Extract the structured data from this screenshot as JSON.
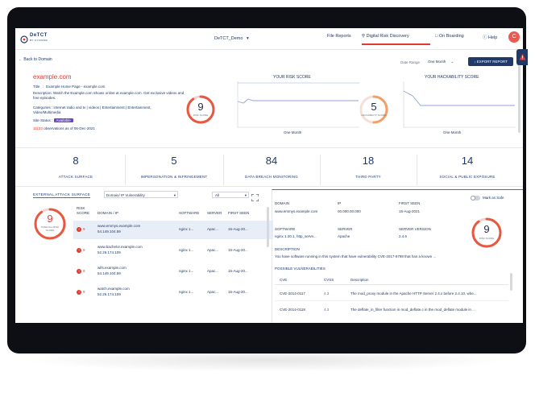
{
  "app": {
    "logo_text": "DeTCT",
    "logo_sub": "BY CYFIRMA",
    "workspace": "DeTCT_Demo",
    "nav": [
      "File Reports",
      "Digital Risk Discovery",
      "On Boarding",
      "Help"
    ],
    "avatar_letter": "C"
  },
  "toolbar": {
    "back_label": "Back to Domain",
    "date_range_label": "Date Range",
    "date_range_value": "One Month",
    "export_label": "EXPORT REPORT"
  },
  "domain": {
    "name": "example.com",
    "title_label": "Title",
    "title_value": "Example Home Page - example.com",
    "description_label": "Description",
    "description_value": "Watch the Example.com Shows online at example.com. Get exclusive videos and free episodes.",
    "categories_label": "Categories",
    "categories_value": "internet radio and tv | videos | Entertainment | Entertainment, Video/Multimedia",
    "site_status_label": "Site Status",
    "site_status_value": "Available",
    "observations_count": "11133",
    "observations_text": "observations as of 06-Dec-2021"
  },
  "risk_score": {
    "value": "9",
    "label": "RISK SCORE",
    "chart_title": "YOUR RISK SCORE",
    "x_label": "One Month"
  },
  "hackability_score": {
    "value": "5",
    "label": "HACKABILITY SCORE",
    "chart_title": "YOUR HACKABILITY SCORE",
    "x_label": "One Month"
  },
  "kpis": [
    {
      "value": "8",
      "label": "ATTACK SURFACE"
    },
    {
      "value": "5",
      "label": "IMPERSONATION & INFRINGEMENT"
    },
    {
      "value": "84",
      "label": "DATA BREACH MONITORING"
    },
    {
      "value": "18",
      "label": "THIRD PARTY"
    },
    {
      "value": "14",
      "label": "SOCIAL & PUBLIC EXPOSURE"
    }
  ],
  "attack_surface": {
    "title": "EXTERNAL ATTACK SURFACE",
    "filter_value": "Domain/ IP Vulnerability",
    "all_value": "All",
    "overall_score": "9",
    "overall_label": "OVER ALL RISK SCORE",
    "columns": [
      "RISK SCORE",
      "DOMAIN / IP",
      "SOFTWARE",
      "SERVER",
      "FIRST SEEN"
    ],
    "rows": [
      {
        "score": "9",
        "domain": "www.emmys.example.com",
        "ip": "54.149.104.59",
        "software": "nginx 1...",
        "server": "Apac...",
        "first_seen": "15-Aug-20..."
      },
      {
        "score": "9",
        "domain": "www.bachelor.example.com",
        "ip": "52.26.174.109",
        "software": "nginx 1...",
        "server": "Apac...",
        "first_seen": "15-Aug-20..."
      },
      {
        "score": "9",
        "domain": "wifs.example.com",
        "ip": "54.149.104.59",
        "software": "nginx 1...",
        "server": "Apac...",
        "first_seen": "15-Aug-20..."
      },
      {
        "score": "9",
        "domain": "watch.example.com",
        "ip": "52.26.174.109",
        "software": "nginx 1...",
        "server": "Apac...",
        "first_seen": "15-Aug-20..."
      }
    ]
  },
  "detail": {
    "mark_safe": "Mark as Safe",
    "domain_label": "DOMAIN",
    "domain_value": "www.emmys.example.com",
    "ip_label": "IP",
    "ip_value": "00.000.00.000",
    "first_seen_label": "FIRST SEEN",
    "first_seen_value": "15-Aug-2021",
    "software_label": "SOFTWARE",
    "software_value": "nginx 1.20.1, http_serve...",
    "server_label": "SERVER",
    "server_value": "Apache",
    "server_version_label": "SERVER VERSION",
    "server_version_value": "2.4.6",
    "risk_value": "9",
    "risk_label": "RISK SCORE",
    "description_label": "DESCRIPTION",
    "description_value": "You have software running in this system that have vulnerability CVE-2017-9798 that has a known ...",
    "vuln_title": "POSSIBLE VULNERABILITIES",
    "vuln_columns": [
      "CVE",
      "CVSS",
      "Description"
    ],
    "vulns": [
      {
        "cve": "CVE-2014-0117",
        "cvss": "4.3",
        "desc": "The mod_proxy module in the Apache HTTP Server 2.4.x before 2.4.10, whe..."
      },
      {
        "cve": "CVE-2014-0118",
        "cvss": "4.3",
        "desc": "The deflate_in_filter function in mod_deflate.c in the mod_deflate module in ..."
      }
    ]
  },
  "colors": {
    "accent": "#e23b2e",
    "navy": "#1f3a68",
    "chart_line": "#8ea3d8"
  }
}
